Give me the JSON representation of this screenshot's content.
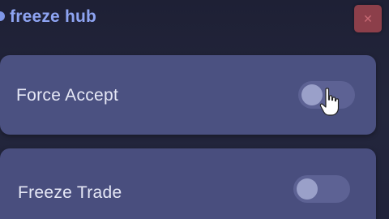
{
  "window": {
    "title": "freeze hub",
    "close_icon": "close-icon"
  },
  "options": [
    {
      "label": "Force Accept",
      "enabled": false
    },
    {
      "label": "Freeze Trade",
      "enabled": false
    }
  ],
  "colors": {
    "background": "#1e2035",
    "title": "#8ea4f2",
    "card": "#4b5181",
    "toggle_track": "#5d6294",
    "toggle_knob": "#9aa0c9",
    "close_button": "#8c3f4a"
  }
}
